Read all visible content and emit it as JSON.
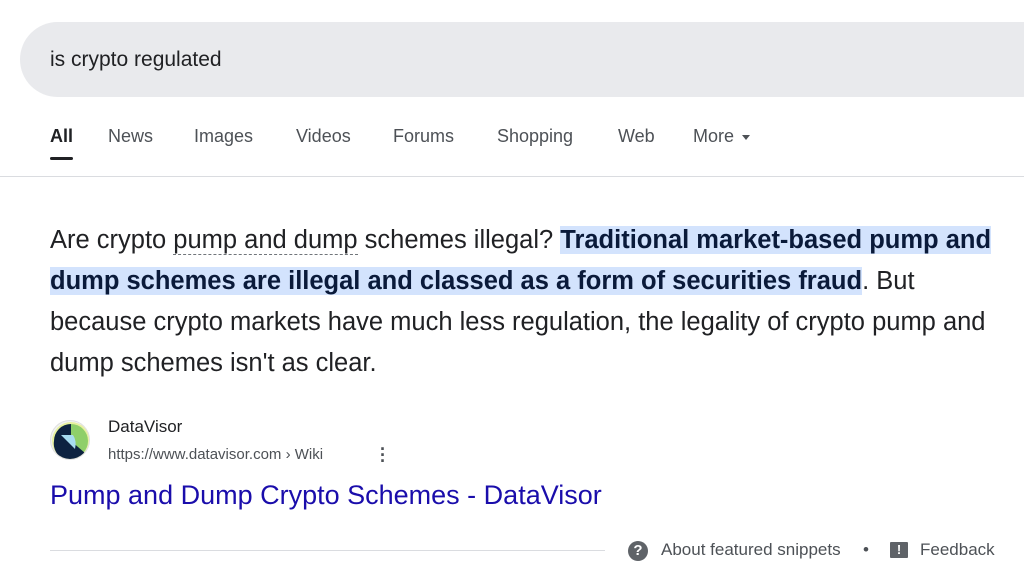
{
  "search": {
    "query": "is crypto regulated"
  },
  "tabs": [
    {
      "label": "All",
      "active": true
    },
    {
      "label": "News"
    },
    {
      "label": "Images"
    },
    {
      "label": "Videos"
    },
    {
      "label": "Forums"
    },
    {
      "label": "Shopping"
    },
    {
      "label": "Web"
    },
    {
      "label": "More"
    }
  ],
  "snippet": {
    "part1": "Are crypto ",
    "term": "pump and dump",
    "part2": " schemes illegal? ",
    "highlight": "Traditional market-based pump and dump schemes are illegal and classed as a form of securities fraud",
    "part3": ". But because crypto markets have much less regulation, the legality of crypto pump and dump schemes isn't as clear.",
    "highlight_color": "#d3e3fd"
  },
  "source": {
    "site_name": "DataVisor",
    "url": "https://www.datavisor.com › Wiki",
    "title": "Pump and Dump Crypto Schemes - DataVisor",
    "link_color": "#1a0dab"
  },
  "footer": {
    "about": "About featured snippets",
    "separator": "•",
    "feedback": "Feedback"
  }
}
